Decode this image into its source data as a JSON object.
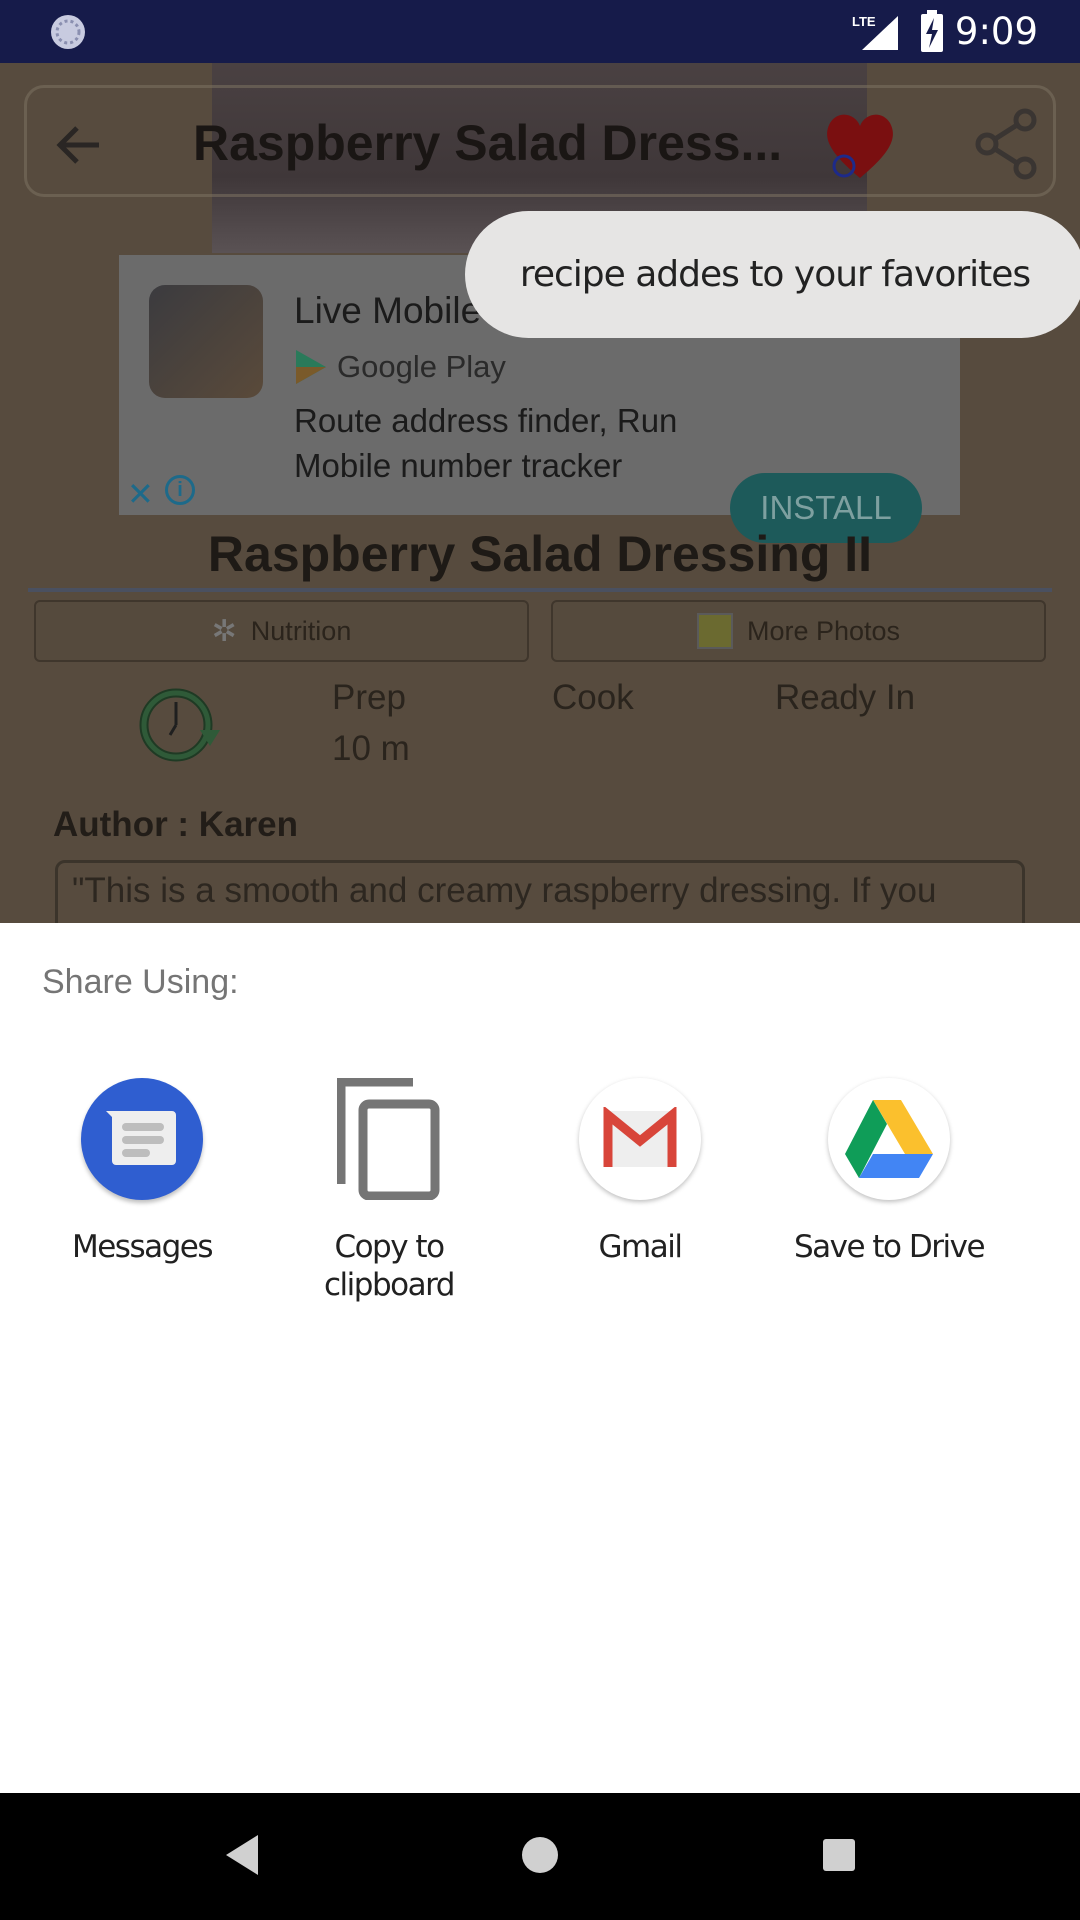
{
  "status_bar": {
    "time": "9:09",
    "network": "LTE",
    "icons": [
      "sync-icon",
      "lte-signal-icon",
      "battery-charging-icon"
    ]
  },
  "app_bar": {
    "title": "Raspberry Salad Dress...",
    "icons": [
      "back-arrow-icon",
      "heart-icon",
      "share-icon"
    ]
  },
  "toast": {
    "text": "recipe addes to your favorites"
  },
  "ad": {
    "title": "Live Mobile Number Tracker",
    "store": "Google Play",
    "description_line1": "Route address finder, Run",
    "description_line2": "Mobile number tracker",
    "install_label": "INSTALL",
    "accent": "#1d5a5a"
  },
  "recipe": {
    "title": "Raspberry Salad Dressing II",
    "nutrition_label": "Nutrition",
    "photos_label": "More Photos",
    "prep_label": "Prep",
    "prep_value": "10 m",
    "cook_label": "Cook",
    "ready_label": "Ready In",
    "author": "Author : Karen",
    "quote": "\"This is a smooth and creamy raspberry dressing.  If you"
  },
  "share_sheet": {
    "header": "Share Using:",
    "targets": [
      {
        "label": "Messages"
      },
      {
        "label": "Copy to\nclipboard"
      },
      {
        "label": "Gmail"
      },
      {
        "label": "Save to Drive"
      }
    ]
  },
  "nav_bar": {
    "buttons": [
      "back",
      "home",
      "recents"
    ]
  }
}
